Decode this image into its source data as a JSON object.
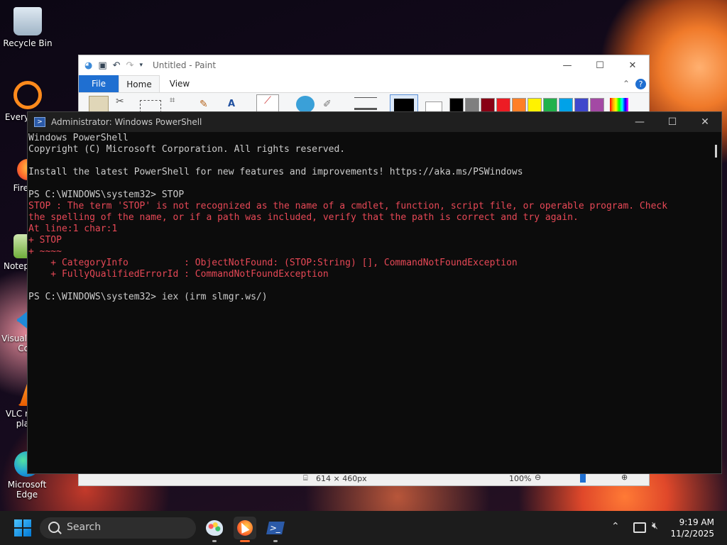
{
  "desktop": {
    "icons": [
      {
        "label": "Recycle Bin"
      },
      {
        "label": "Every"
      },
      {
        "label": "Fire"
      },
      {
        "label": "Notep"
      },
      {
        "label": "Visual"
      },
      {
        "label": "Co"
      },
      {
        "label": "VLC r"
      },
      {
        "label": "pla"
      },
      {
        "label": "Microsoft"
      },
      {
        "label": "Edge"
      }
    ]
  },
  "paint": {
    "title": "Untitled - Paint",
    "tabs": {
      "file": "File",
      "home": "Home",
      "view": "View"
    },
    "status": {
      "size": "614 × 460px",
      "zoom": "100%"
    },
    "palette": [
      "#000000",
      "#7f7f7f",
      "#880015",
      "#ed1c24",
      "#ff7f27",
      "#fff200",
      "#22b14c",
      "#00a2e8",
      "#3f48cc",
      "#a349a4"
    ]
  },
  "powershell": {
    "title": "Administrator: Windows PowerShell",
    "lines": [
      {
        "text": "Windows PowerShell",
        "err": false
      },
      {
        "text": "Copyright (C) Microsoft Corporation. All rights reserved.",
        "err": false
      },
      {
        "text": "",
        "err": false
      },
      {
        "text": "Install the latest PowerShell for new features and improvements! https://aka.ms/PSWindows",
        "err": false
      },
      {
        "text": "",
        "err": false
      },
      {
        "text": "PS C:\\WINDOWS\\system32> STOP",
        "err": false
      },
      {
        "text": "STOP : The term 'STOP' is not recognized as the name of a cmdlet, function, script file, or operable program. Check",
        "err": true
      },
      {
        "text": "the spelling of the name, or if a path was included, verify that the path is correct and try again.",
        "err": true
      },
      {
        "text": "At line:1 char:1",
        "err": true
      },
      {
        "text": "+ STOP",
        "err": true
      },
      {
        "text": "+ ~~~~",
        "err": true
      },
      {
        "text": "    + CategoryInfo          : ObjectNotFound: (STOP:String) [], CommandNotFoundException",
        "err": true
      },
      {
        "text": "    + FullyQualifiedErrorId : CommandNotFoundException",
        "err": true
      },
      {
        "text": "",
        "err": false
      },
      {
        "text": "PS C:\\WINDOWS\\system32> iex (irm slmgr.ws/)",
        "err": false
      }
    ]
  },
  "taskbar": {
    "search_label": "Search",
    "time": "9:19 AM",
    "date": "11/2/2025"
  }
}
